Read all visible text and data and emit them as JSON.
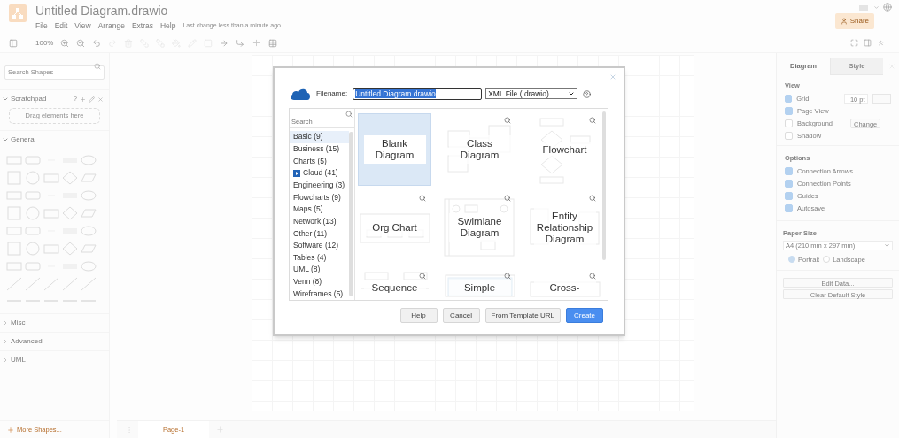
{
  "app": {
    "title": "Untitled Diagram.drawio",
    "menu": [
      "File",
      "Edit",
      "View",
      "Arrange",
      "Extras",
      "Help"
    ],
    "last_change": "Last change less than a minute ago",
    "share_button": "Share",
    "zoom": "100%"
  },
  "sidebar": {
    "search_placeholder": "Search Shapes",
    "sections": [
      {
        "label": "Scratchpad",
        "expanded": true,
        "kind": "scratchpad"
      },
      {
        "label": "General",
        "expanded": true,
        "kind": "shapes"
      },
      {
        "label": "Misc",
        "expanded": false,
        "kind": "library"
      },
      {
        "label": "Advanced",
        "expanded": false,
        "kind": "library"
      },
      {
        "label": "UML",
        "expanded": false,
        "kind": "library"
      }
    ],
    "scratchpad_hint": "Drag elements here",
    "scratchpad_help": "?",
    "more_shapes": "More Shapes..."
  },
  "pages": [
    {
      "label": "Page-1",
      "selected": true
    }
  ],
  "format_panel": {
    "tabs": [
      {
        "label": "Diagram",
        "selected": true
      },
      {
        "label": "Style",
        "selected": false
      }
    ],
    "view_title": "View",
    "view_options": [
      {
        "label": "Grid",
        "checked": true,
        "kind": "grid"
      },
      {
        "label": "Page View",
        "checked": true,
        "kind": "plain"
      },
      {
        "label": "Background",
        "checked": false,
        "kind": "background"
      },
      {
        "label": "Shadow",
        "checked": false,
        "kind": "plain"
      }
    ],
    "grid_size": "10 pt",
    "background_button": "Change",
    "options_title": "Options",
    "options": [
      {
        "label": "Connection Arrows",
        "checked": true
      },
      {
        "label": "Connection Points",
        "checked": true
      },
      {
        "label": "Guides",
        "checked": true
      },
      {
        "label": "Autosave",
        "checked": true
      }
    ],
    "paper_size_title": "Paper Size",
    "paper_size": "A4 (210 mm x 297 mm)",
    "orientation": [
      {
        "label": "Portrait",
        "selected": true
      },
      {
        "label": "Landscape",
        "selected": false
      }
    ],
    "buttons": [
      "Edit Data...",
      "Clear Default Style"
    ]
  },
  "dialog": {
    "filename_label": "Filename:",
    "filename": "Untitled Diagram.drawio",
    "file_type": "XML File (.drawio)",
    "search_placeholder": "Search",
    "categories": [
      {
        "label": "Basic (9)",
        "selected": true,
        "kind": "plain"
      },
      {
        "label": "Business (15)",
        "selected": false,
        "kind": "plain"
      },
      {
        "label": "Charts (5)",
        "selected": false,
        "kind": "plain"
      },
      {
        "label": "Cloud (41)",
        "selected": false,
        "kind": "iconed"
      },
      {
        "label": "Engineering (3)",
        "selected": false,
        "kind": "plain"
      },
      {
        "label": "Flowcharts (9)",
        "selected": false,
        "kind": "plain"
      },
      {
        "label": "Maps (5)",
        "selected": false,
        "kind": "plain"
      },
      {
        "label": "Network (13)",
        "selected": false,
        "kind": "plain"
      },
      {
        "label": "Other (11)",
        "selected": false,
        "kind": "plain"
      },
      {
        "label": "Software (12)",
        "selected": false,
        "kind": "plain"
      },
      {
        "label": "Tables (4)",
        "selected": false,
        "kind": "plain"
      },
      {
        "label": "UML (8)",
        "selected": false,
        "kind": "plain"
      },
      {
        "label": "Venn (8)",
        "selected": false,
        "kind": "plain"
      },
      {
        "label": "Wireframes (5)",
        "selected": false,
        "kind": "plain"
      }
    ],
    "templates": [
      {
        "label": "Blank Diagram",
        "selected": true,
        "kind": "blank"
      },
      {
        "label": "Class Diagram",
        "selected": false,
        "kind": "class"
      },
      {
        "label": "Flowchart",
        "selected": false,
        "kind": "flowchart"
      },
      {
        "label": "Org Chart",
        "selected": false,
        "kind": "org"
      },
      {
        "label": "Swimlane Diagram",
        "selected": false,
        "kind": "swimlane"
      },
      {
        "label": "Entity Relationship Diagram",
        "selected": false,
        "kind": "er"
      },
      {
        "label": "Sequence",
        "selected": false,
        "kind": "sequence"
      },
      {
        "label": "Simple",
        "selected": false,
        "kind": "simple"
      },
      {
        "label": "Cross-",
        "selected": false,
        "kind": "cross"
      }
    ],
    "buttons": [
      {
        "label": "Help",
        "kind": "default"
      },
      {
        "label": "Cancel",
        "kind": "default"
      },
      {
        "label": "From Template URL",
        "kind": "default"
      },
      {
        "label": "Create",
        "kind": "primary"
      }
    ]
  }
}
